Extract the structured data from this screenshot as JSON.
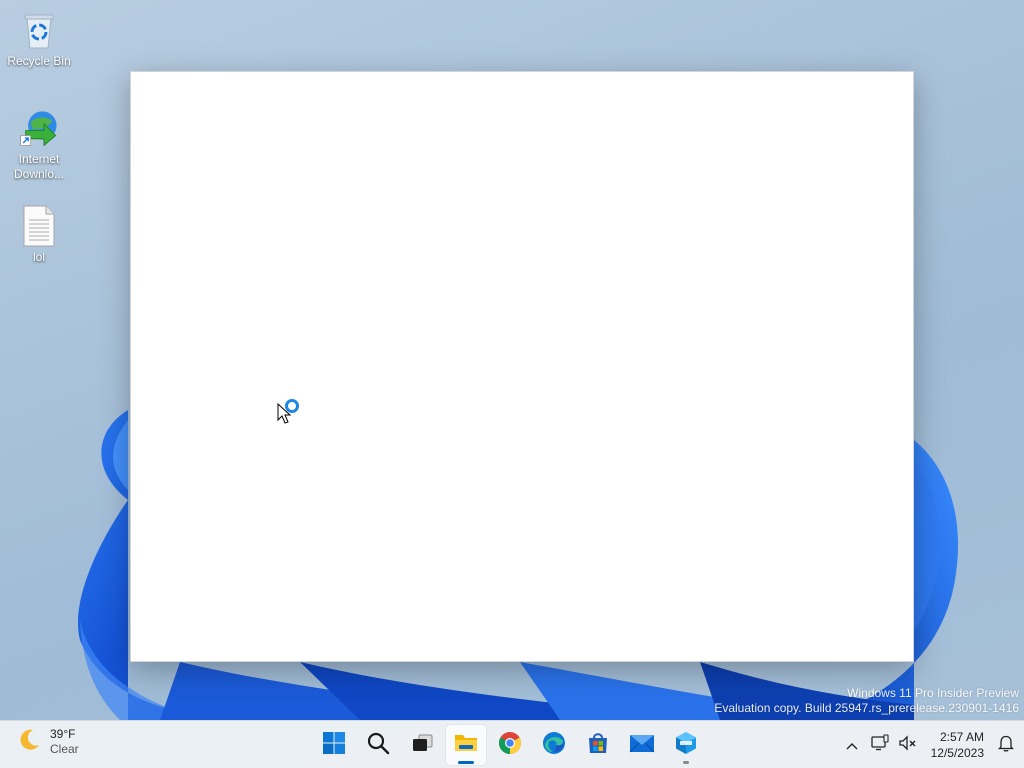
{
  "desktop": {
    "icons": [
      {
        "label": "Recycle Bin",
        "icon": "recycle-bin-icon"
      },
      {
        "label": "Internet Downlo...",
        "icon": "internet-download-manager-icon"
      },
      {
        "label": "lol",
        "icon": "text-file-icon"
      }
    ]
  },
  "watermark": {
    "line1": "Windows 11 Pro Insider Preview",
    "line2": "Evaluation copy. Build 25947.rs_prerelease.230901-1416"
  },
  "taskbar": {
    "weather": {
      "temperature": "39°F",
      "condition": "Clear",
      "icon": "moon-icon"
    },
    "apps": [
      {
        "name": "start",
        "icon": "windows-start-icon"
      },
      {
        "name": "search",
        "icon": "search-icon"
      },
      {
        "name": "task-view",
        "icon": "task-view-icon"
      },
      {
        "name": "file-explorer",
        "icon": "folder-icon",
        "active": true
      },
      {
        "name": "chrome",
        "icon": "chrome-icon"
      },
      {
        "name": "edge",
        "icon": "edge-icon"
      },
      {
        "name": "store",
        "icon": "store-icon"
      },
      {
        "name": "mail",
        "icon": "mail-icon"
      },
      {
        "name": "app",
        "icon": "cube-app-icon",
        "open": true
      }
    ],
    "tray": {
      "time": "2:57 AM",
      "date": "12/5/2023"
    }
  },
  "colors": {
    "accent": "#0067c0",
    "wallpaper_blue": "#1a5fe0",
    "taskbar_bg": "#eef1f5"
  }
}
